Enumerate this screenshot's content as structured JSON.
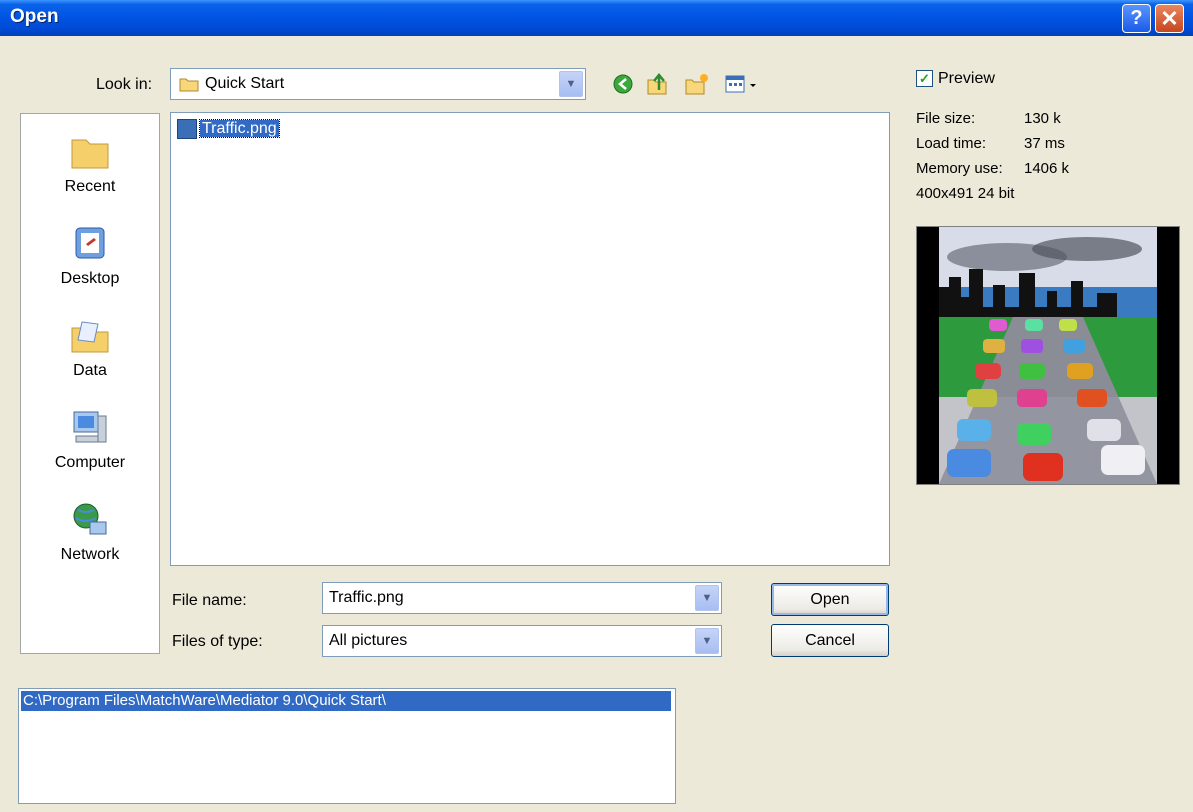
{
  "window": {
    "title": "Open"
  },
  "look_in": {
    "label": "Look in:",
    "value": "Quick Start"
  },
  "places": [
    {
      "label": "Recent",
      "icon": "folder-icon"
    },
    {
      "label": "Desktop",
      "icon": "desktop-icon"
    },
    {
      "label": "Data",
      "icon": "data-folder-icon"
    },
    {
      "label": "Computer",
      "icon": "computer-icon"
    },
    {
      "label": "Network",
      "icon": "network-icon"
    }
  ],
  "files": [
    {
      "name": "Traffic.png",
      "selected": true
    }
  ],
  "file_name": {
    "label": "File name:",
    "value": "Traffic.png"
  },
  "file_type": {
    "label": "Files of type:",
    "value": "All pictures"
  },
  "buttons": {
    "open": "Open",
    "cancel": "Cancel"
  },
  "preview": {
    "label": "Preview",
    "checked": true,
    "file_size_label": "File size:",
    "file_size": "130 k",
    "load_time_label": "Load time:",
    "load_time": "37 ms",
    "memory_label": "Memory use:",
    "memory": "1406 k",
    "dimensions": "400x491 24 bit"
  },
  "path": "C:\\Program Files\\MatchWare\\Mediator 9.0\\Quick Start\\",
  "colors": {
    "titlebar": "#0054e3",
    "dialog_bg": "#ece9d8",
    "selection": "#316ac5"
  }
}
